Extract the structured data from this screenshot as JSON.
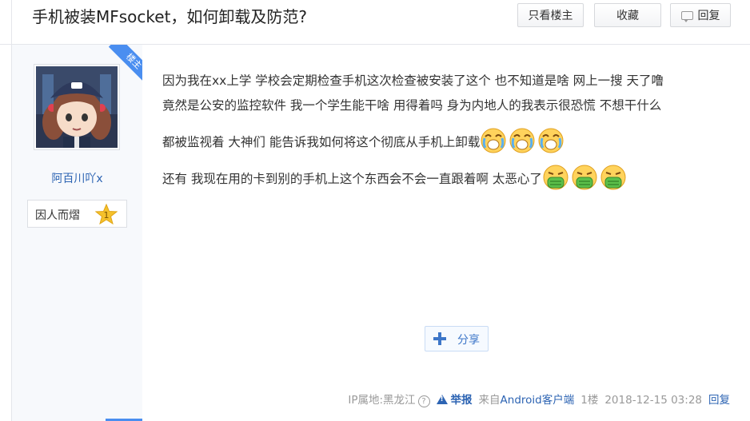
{
  "thread": {
    "title": "手机被装MFsocket，如何卸载及防范?",
    "buttons": {
      "only_op": "只看楼主",
      "favorite": "收藏",
      "reply": "回复"
    }
  },
  "author": {
    "op_badge": "楼主",
    "name": "阿百川吖x",
    "tag": "因人而熠",
    "level": "1"
  },
  "post": {
    "lines": [
      "因为我在xx上学 学校会定期检查手机这次检查被安装了这个 也不知道是啥 网上一搜 天了噜",
      "竟然是公安的监控软件 我一个学生能干啥 用得着吗 身为内地人的我表示很恐慌 不想干什么",
      "都被监视着 大神们 能告诉我如何将这个彻底从手机上卸载",
      "还有 我现在用的卡到别的手机上这个东西会不会一直跟着啊 太恶心了"
    ],
    "emoji_line3": [
      "crying-emoji",
      "crying-emoji",
      "crying-emoji"
    ],
    "emoji_line4": [
      "vomit-emoji",
      "vomit-emoji",
      "vomit-emoji"
    ],
    "share_label": "分享"
  },
  "footer": {
    "ip": "IP属地:黑龙江",
    "report": "举报",
    "source": "来自Android客户端",
    "floor": "1楼",
    "time": "2018-12-15 03:28",
    "reply": "回复"
  },
  "colors": {
    "link": "#2d64b3",
    "accent": "#4a8ef0",
    "sidebar_bg": "#f7f9fc"
  }
}
